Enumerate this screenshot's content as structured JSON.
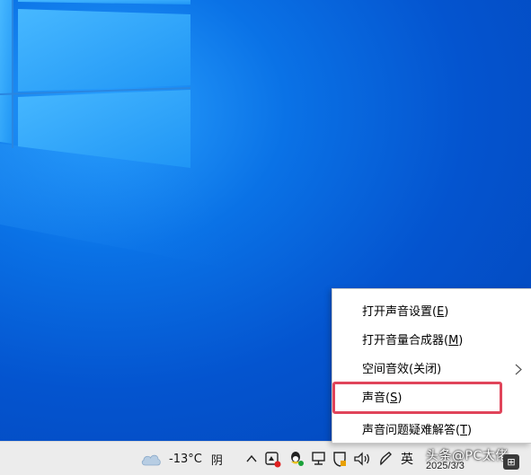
{
  "desktop": {
    "wallpaper": "windows-10-hero"
  },
  "taskbar": {
    "weather": {
      "icon": "cloud-icon",
      "temperature": "-13°C",
      "condition": "阴"
    },
    "tray_icons": [
      "chevron-up-icon",
      "app-notification-icon",
      "qq-icon",
      "network-icon",
      "security-shield-icon",
      "volume-icon",
      "pen-icon"
    ],
    "language": "英",
    "date": "2025/3/3",
    "watermark": "头条@PC太佬",
    "notification_glyph": "⊞"
  },
  "context_menu": {
    "items": [
      {
        "text": "打开声音设置(",
        "key": "E",
        "suffix": ")",
        "has_submenu": false
      },
      {
        "text": "打开音量合成器(",
        "key": "M",
        "suffix": ")",
        "has_submenu": false
      },
      {
        "text": "空间音效(关闭)",
        "key": "",
        "suffix": "",
        "has_submenu": true
      },
      {
        "text": "声音(",
        "key": "S",
        "suffix": ")",
        "has_submenu": false,
        "highlighted": true
      },
      {
        "text": "声音问题疑难解答(",
        "key": "T",
        "suffix": ")",
        "has_submenu": false
      }
    ],
    "highlight_color": "#e0445a"
  }
}
